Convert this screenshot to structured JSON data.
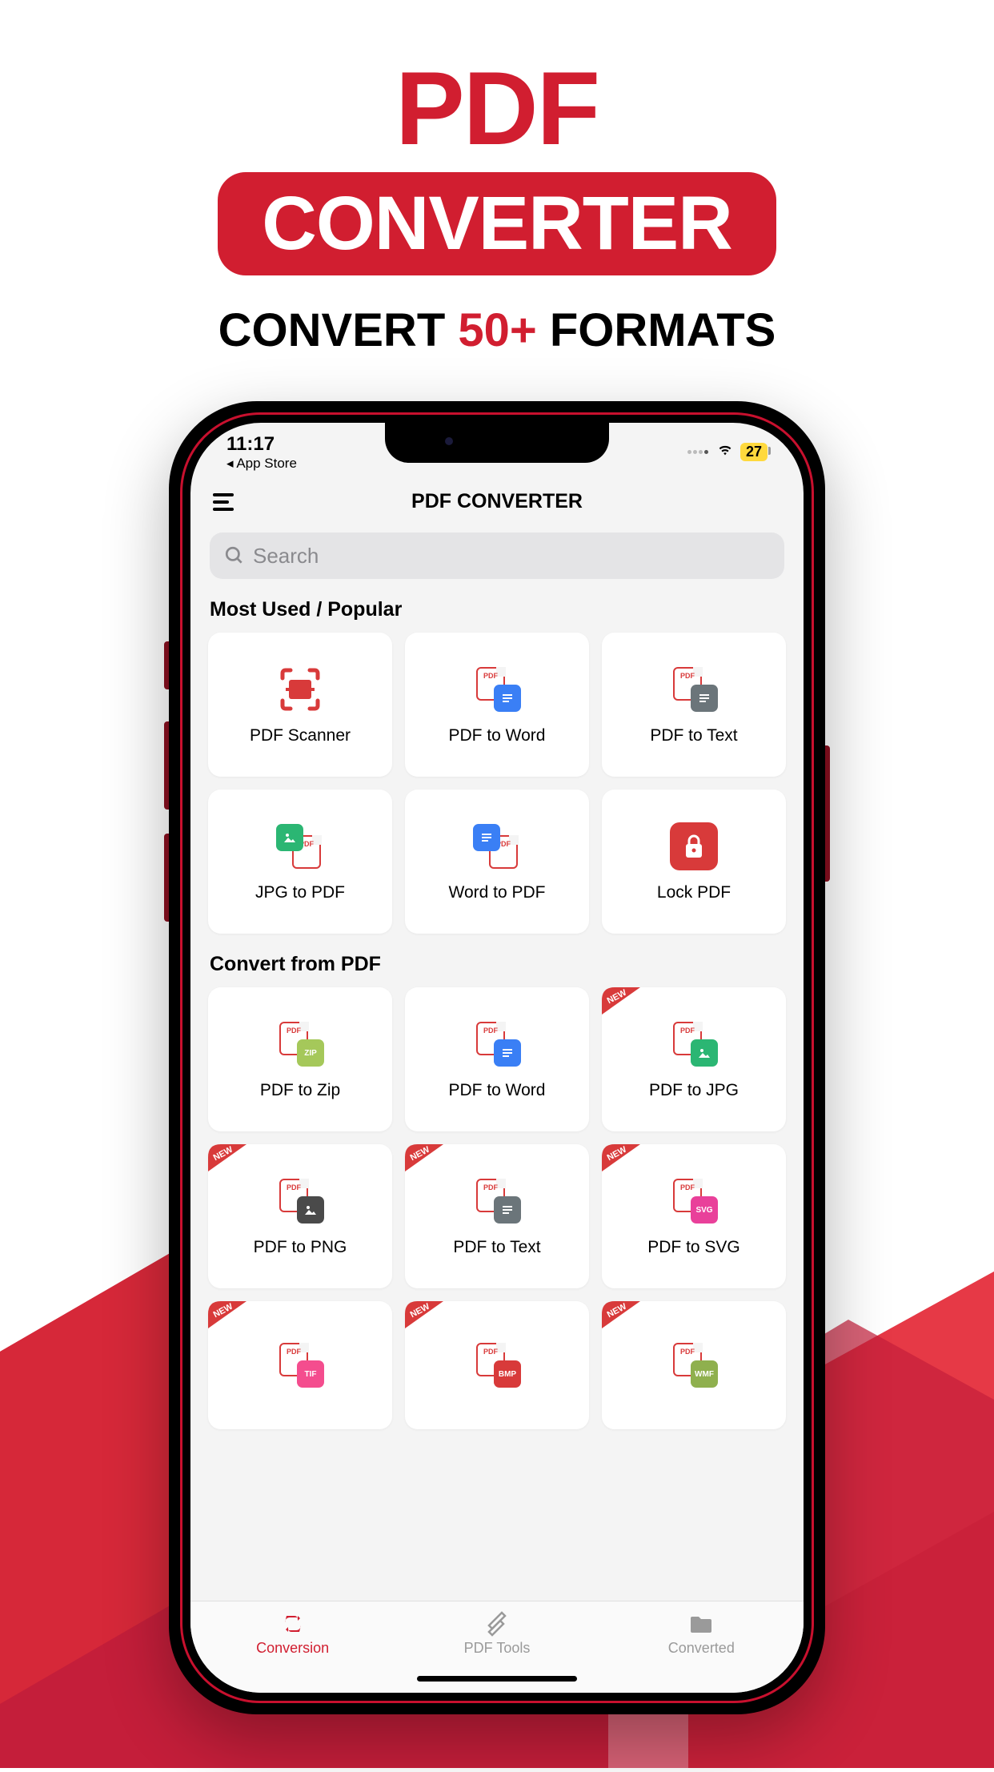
{
  "hero": {
    "title": "PDF",
    "pill": "CONVERTER",
    "sub_pre": "CONVERT ",
    "sub_accent": "50+",
    "sub_post": " FORMATS"
  },
  "status": {
    "time": "11:17",
    "back": "◂ App Store",
    "battery": "27"
  },
  "app": {
    "title": "PDF CONVERTER"
  },
  "search": {
    "placeholder": "Search"
  },
  "sections": {
    "popular": {
      "title": "Most Used / Popular",
      "items": [
        {
          "label": "PDF Scanner"
        },
        {
          "label": "PDF to Word"
        },
        {
          "label": "PDF to Text"
        },
        {
          "label": "JPG to PDF"
        },
        {
          "label": "Word to PDF"
        },
        {
          "label": "Lock PDF"
        }
      ]
    },
    "from_pdf": {
      "title": "Convert from PDF",
      "items": [
        {
          "label": "PDF to Zip",
          "new": false,
          "tag": "ZIP"
        },
        {
          "label": "PDF to Word",
          "new": false
        },
        {
          "label": "PDF to JPG",
          "new": true
        },
        {
          "label": "PDF to PNG",
          "new": true
        },
        {
          "label": "PDF to Text",
          "new": true
        },
        {
          "label": "PDF to SVG",
          "new": true,
          "tag": "SVG"
        },
        {
          "label": "",
          "new": true,
          "tag": "TIF"
        },
        {
          "label": "",
          "new": true,
          "tag": "BMP"
        },
        {
          "label": "",
          "new": true,
          "tag": "WMF"
        }
      ]
    }
  },
  "tabs": [
    {
      "label": "Conversion",
      "active": true
    },
    {
      "label": "PDF Tools",
      "active": false
    },
    {
      "label": "Converted",
      "active": false
    }
  ],
  "badge": {
    "new": "NEW"
  }
}
